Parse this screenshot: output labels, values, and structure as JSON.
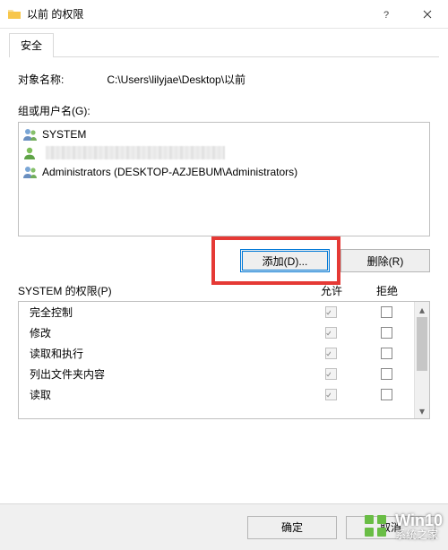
{
  "window": {
    "title": "以前 的权限"
  },
  "tabs": {
    "security": "安全"
  },
  "object": {
    "label": "对象名称:",
    "path": "C:\\Users\\lilyjae\\Desktop\\以前"
  },
  "groups": {
    "label": "组或用户名(G):",
    "items": [
      {
        "name": "SYSTEM",
        "icon": "group"
      },
      {
        "name": "",
        "icon": "user",
        "redacted": true
      },
      {
        "name": "Administrators (DESKTOP-AZJEBUM\\Administrators)",
        "icon": "group"
      }
    ]
  },
  "buttons": {
    "add": "添加(D)...",
    "remove": "删除(R)",
    "ok": "确定",
    "cancel": "取消"
  },
  "permissions": {
    "title": "SYSTEM 的权限(P)",
    "allow_col": "允许",
    "deny_col": "拒绝",
    "rows": [
      {
        "name": "完全控制",
        "allow": true,
        "deny": false
      },
      {
        "name": "修改",
        "allow": true,
        "deny": false
      },
      {
        "name": "读取和执行",
        "allow": true,
        "deny": false
      },
      {
        "name": "列出文件夹内容",
        "allow": true,
        "deny": false
      },
      {
        "name": "读取",
        "allow": true,
        "deny": false
      }
    ]
  },
  "watermark": {
    "big": "Win10",
    "small": "系统之家"
  }
}
